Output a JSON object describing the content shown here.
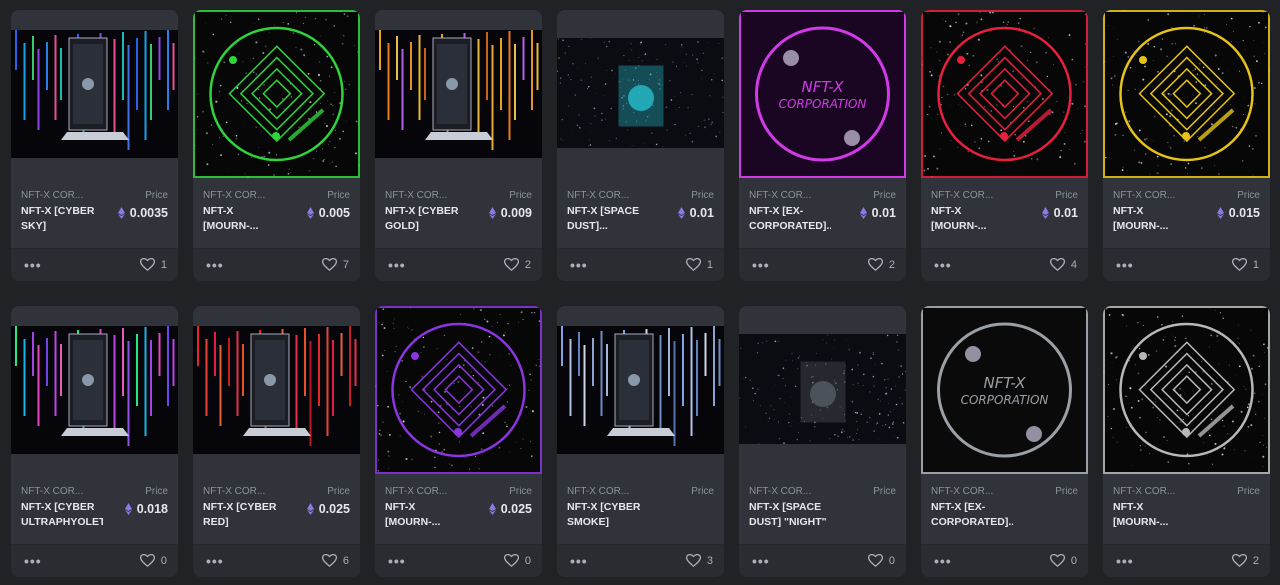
{
  "price_label": "Price",
  "colors": {
    "card_bg": "#303339",
    "page_bg": "#202225",
    "eth": "#8c79e6"
  },
  "cards": [
    {
      "collection": "NFT-X COR...",
      "name": "NFT-X [CYBER SKY]",
      "price": "0.0035",
      "likes": "1",
      "art": "rain",
      "accent": "multi-blue"
    },
    {
      "collection": "NFT-X COR...",
      "name": "NFT-X [MOURN-...",
      "price": "0.005",
      "likes": "7",
      "art": "circle",
      "accent": "#2fd33c"
    },
    {
      "collection": "NFT-X COR...",
      "name": "NFT-X [CYBER GOLD]",
      "price": "0.009",
      "likes": "2",
      "art": "rain",
      "accent": "gold"
    },
    {
      "collection": "NFT-X COR...",
      "name": "NFT-X [SPACE DUST]...",
      "price": "0.01",
      "likes": "1",
      "art": "space",
      "accent": "#27c6d6"
    },
    {
      "collection": "NFT-X COR...",
      "name": "NFT-X [EX-CORPORATED]...",
      "price": "0.01",
      "likes": "2",
      "art": "logo",
      "accent": "#d13be6",
      "logo_text": [
        "NFT-X",
        "CORPORATION"
      ]
    },
    {
      "collection": "NFT-X COR...",
      "name": "NFT-X [MOURN-...",
      "price": "0.01",
      "likes": "4",
      "art": "circle",
      "accent": "#e8203d"
    },
    {
      "collection": "NFT-X COR...",
      "name": "NFT-X [MOURN-...",
      "price": "0.015",
      "likes": "1",
      "art": "circle",
      "accent": "#e6c318"
    },
    {
      "collection": "NFT-X COR...",
      "name": "NFT-X [CYBER ULTRAPHYOLET]",
      "price": "0.018",
      "likes": "0",
      "art": "rain",
      "accent": "violet"
    },
    {
      "collection": "NFT-X COR...",
      "name": "NFT-X [CYBER RED]",
      "price": "0.025",
      "likes": "6",
      "art": "rain",
      "accent": "red"
    },
    {
      "collection": "NFT-X COR...",
      "name": "NFT-X [MOURN-...",
      "price": "0.025",
      "likes": "0",
      "art": "circle",
      "accent": "#8a35e0"
    },
    {
      "collection": "NFT-X COR...",
      "name": "NFT-X [CYBER SMOKE]",
      "price": "",
      "likes": "3",
      "art": "rain",
      "accent": "smoke"
    },
    {
      "collection": "NFT-X COR...",
      "name": "NFT-X [SPACE DUST] \"NIGHT\"",
      "price": "",
      "likes": "0",
      "art": "space",
      "accent": "#5a6068"
    },
    {
      "collection": "NFT-X COR...",
      "name": "NFT-X [EX-CORPORATED]...",
      "price": "",
      "likes": "0",
      "art": "logo",
      "accent": "#9aa0a6",
      "logo_text": [
        "NFT-X",
        "CORPORATION"
      ]
    },
    {
      "collection": "NFT-X COR...",
      "name": "NFT-X [MOURN-...",
      "price": "",
      "likes": "2",
      "art": "circle",
      "accent": "#b8b8b8"
    }
  ]
}
